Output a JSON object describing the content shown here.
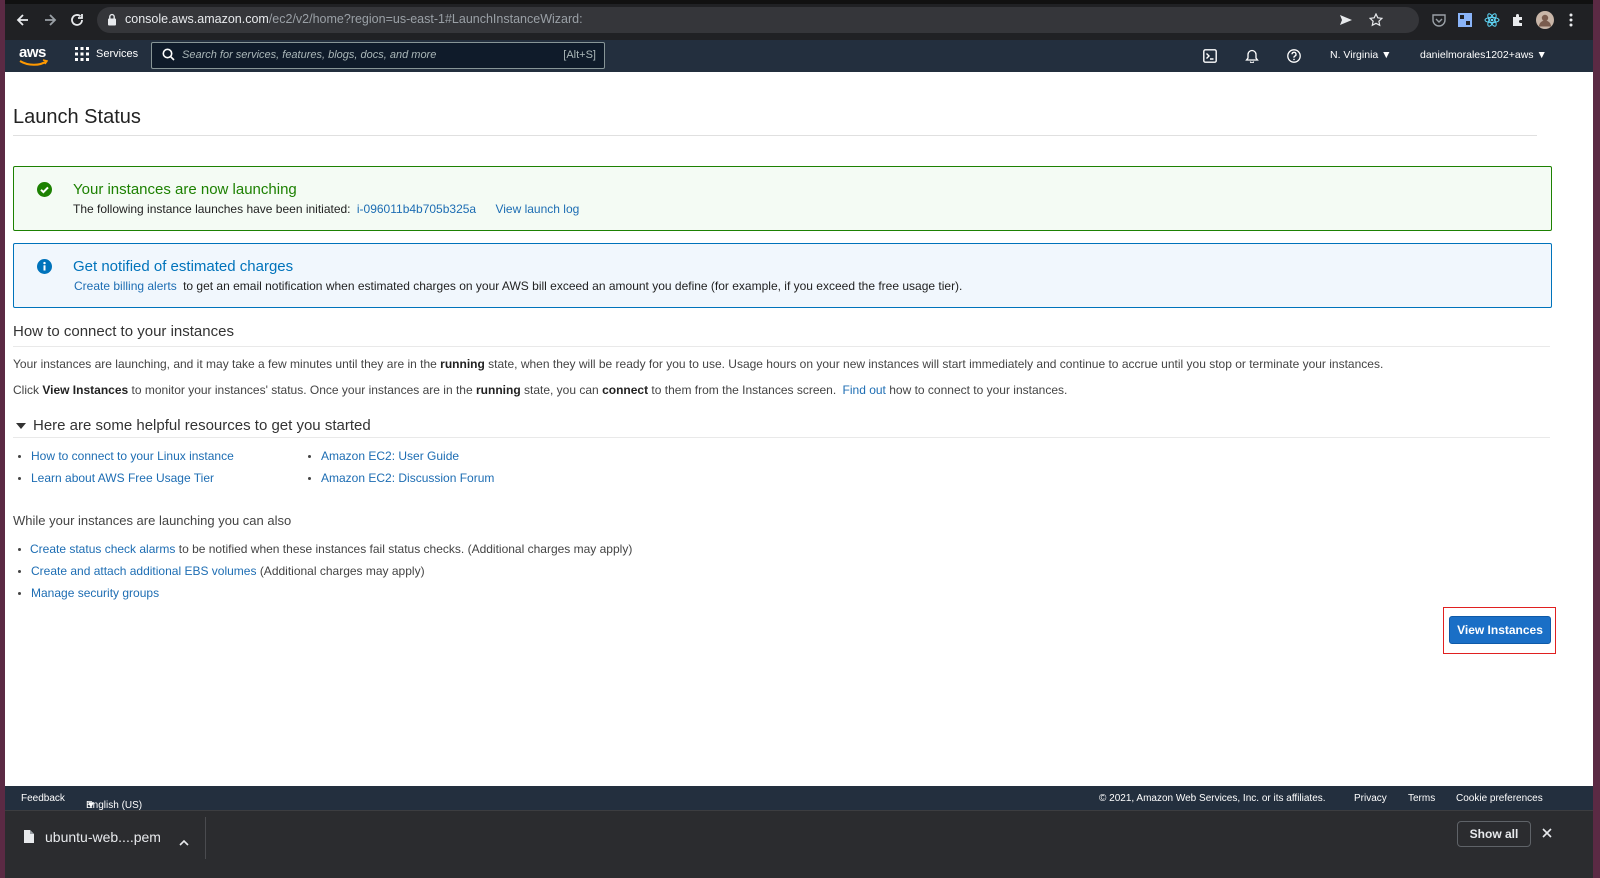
{
  "browser": {
    "url_host": "console.aws.amazon.com",
    "url_path": "/ec2/v2/home?region=us-east-1#LaunchInstanceWizard:"
  },
  "aws_nav": {
    "logo": "aws",
    "services_label": "Services",
    "search_placeholder": "Search for services, features, blogs, docs, and more",
    "search_shortcut": "[Alt+S]",
    "region": "N. Virginia",
    "account": "danielmorales1202+aws"
  },
  "page": {
    "title": "Launch Status",
    "success_alert": {
      "heading": "Your instances are now launching",
      "body_prefix": "The following instance launches have been initiated:",
      "instance_id": "i-096011b4b705b325a",
      "view_log": "View launch log"
    },
    "info_alert": {
      "heading": "Get notified of estimated charges",
      "link": "Create billing alerts",
      "body_suffix": "to get an email notification when estimated charges on your AWS bill exceed an amount you define (for example, if you exceed the free usage tier)."
    },
    "connect": {
      "heading": "How to connect to your instances",
      "p1_a": "Your instances are launching, and it may take a few minutes until they are in the",
      "p1_b": "running",
      "p1_c": "state, when they will be ready for you to use. Usage hours on your new instances will start immediately and continue to accrue until you stop or terminate your instances.",
      "p2_a": "Click",
      "p2_b": "View Instances",
      "p2_c": "to monitor your instances' status. Once your instances are in the",
      "p2_d": "running",
      "p2_e": "state, you can",
      "p2_f": "connect",
      "p2_g": "to them from the Instances screen.",
      "p2_link": "Find out",
      "p2_h": "how to connect to your instances."
    },
    "resources": {
      "heading": "Here are some helpful resources to get you started",
      "left": [
        "How to connect to your Linux instance",
        "Learn about AWS Free Usage Tier"
      ],
      "right": [
        "Amazon EC2: User Guide",
        "Amazon EC2: Discussion Forum"
      ]
    },
    "also": {
      "heading": "While your instances are launching you can also",
      "item1_link": "Create status check alarms",
      "item1_text": "to be notified when these instances fail status checks. (Additional charges may apply)",
      "item2_link": "Create and attach additional EBS volumes",
      "item2_text": "(Additional charges may apply)",
      "item3_link": "Manage security groups"
    },
    "view_instances_button": "View Instances"
  },
  "footer": {
    "feedback": "Feedback",
    "language": "English (US)",
    "copyright": "© 2021, Amazon Web Services, Inc. or its affiliates.",
    "privacy": "Privacy",
    "terms": "Terms",
    "cookies": "Cookie preferences"
  },
  "downloads": {
    "filename": "ubuntu-web....pem",
    "show_all": "Show all"
  }
}
